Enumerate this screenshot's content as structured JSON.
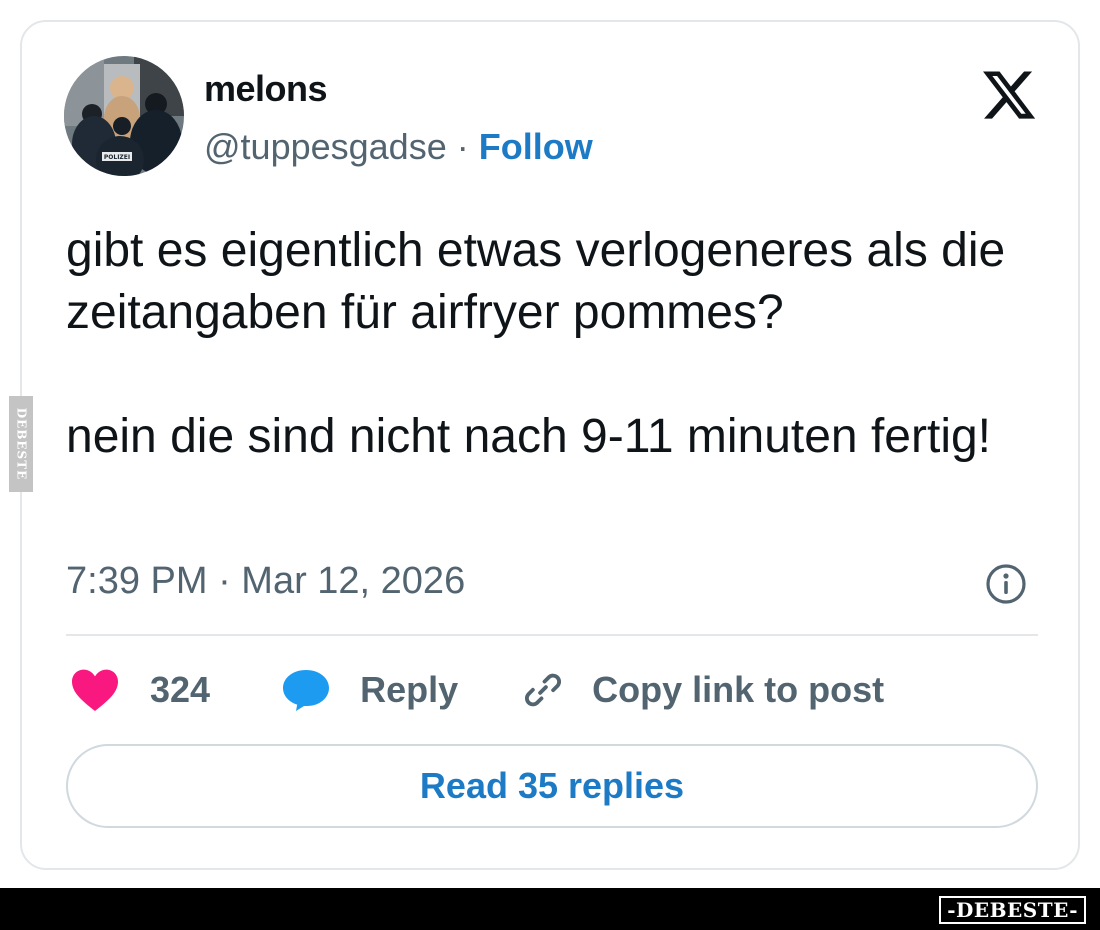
{
  "tweet": {
    "author": {
      "display_name": "melons",
      "handle": "@tuppesgadse",
      "separator": " · ",
      "follow_label": "Follow",
      "avatar_badge_text": "POLIZEI"
    },
    "brand_icon": "x-logo-icon",
    "text_paragraphs": [
      "gibt es eigentlich etwas verlogeneres als die zeitangaben für airfryer pommes?",
      "nein die sind nicht nach 9-11 minuten fertig!"
    ],
    "timestamp": "7:39 PM · Mar 12, 2026",
    "actions": {
      "like_count": "324",
      "reply_label": "Reply",
      "copy_link_label": "Copy link to post"
    },
    "read_replies_label": "Read 35 replies"
  },
  "watermark": {
    "side_text": "DEBESTE",
    "bottom_text": "-DEBESTE-"
  },
  "colors": {
    "follow_blue": "#1d7bc6",
    "heart_pink": "#f91880",
    "reply_blue": "#1d9bf0",
    "text_primary": "#0f1419",
    "text_secondary": "#536471"
  }
}
